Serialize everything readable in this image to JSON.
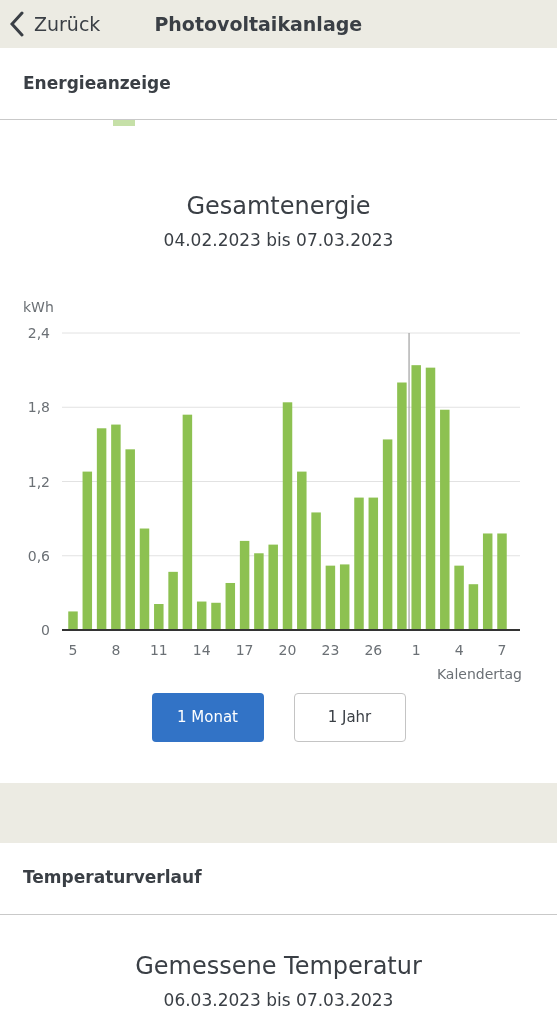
{
  "header": {
    "back_label": "Zurück",
    "title": "Photovoltaikanlage"
  },
  "energy_section": {
    "heading": "Energieanzeige",
    "chart_title": "Gesamtenergie",
    "date_range": "04.02.2023 bis 07.03.2023",
    "chart_data": {
      "type": "bar",
      "ylabel": "kWh",
      "xlabel": "Kalendertag",
      "ylim": [
        0,
        2.4
      ],
      "yticks": [
        {
          "value": 0,
          "label": "0"
        },
        {
          "value": 0.6,
          "label": "0,6"
        },
        {
          "value": 1.2,
          "label": "1,2"
        },
        {
          "value": 1.8,
          "label": "1,8"
        },
        {
          "value": 2.4,
          "label": "2,4"
        }
      ],
      "grid": true,
      "categories": [
        "5",
        null,
        null,
        "8",
        null,
        null,
        "11",
        null,
        null,
        "14",
        null,
        null,
        "17",
        null,
        null,
        "20",
        null,
        null,
        "23",
        null,
        null,
        "26",
        null,
        null,
        "1",
        null,
        null,
        "4",
        null,
        null,
        "7"
      ],
      "series": [
        {
          "color": "#8dc151",
          "values": [
            0.15,
            1.28,
            1.63,
            1.66,
            1.46,
            0.82,
            0.21,
            0.47,
            1.74,
            0.23,
            0.22,
            0.38,
            0.72,
            0.62,
            0.69,
            1.84,
            1.28,
            0.95,
            0.52,
            0.53,
            1.07,
            1.07,
            1.54,
            2.0,
            2.14,
            2.12,
            1.78,
            0.52,
            0.37,
            0.78,
            0.78
          ]
        }
      ]
    },
    "range_buttons": [
      {
        "label": "1 Monat",
        "selected": true
      },
      {
        "label": "1 Jahr",
        "selected": false
      }
    ]
  },
  "temperature_section": {
    "heading": "Temperaturverlauf",
    "chart_title": "Gemessene Temperatur",
    "date_range": "06.03.2023 bis 07.03.2023"
  }
}
